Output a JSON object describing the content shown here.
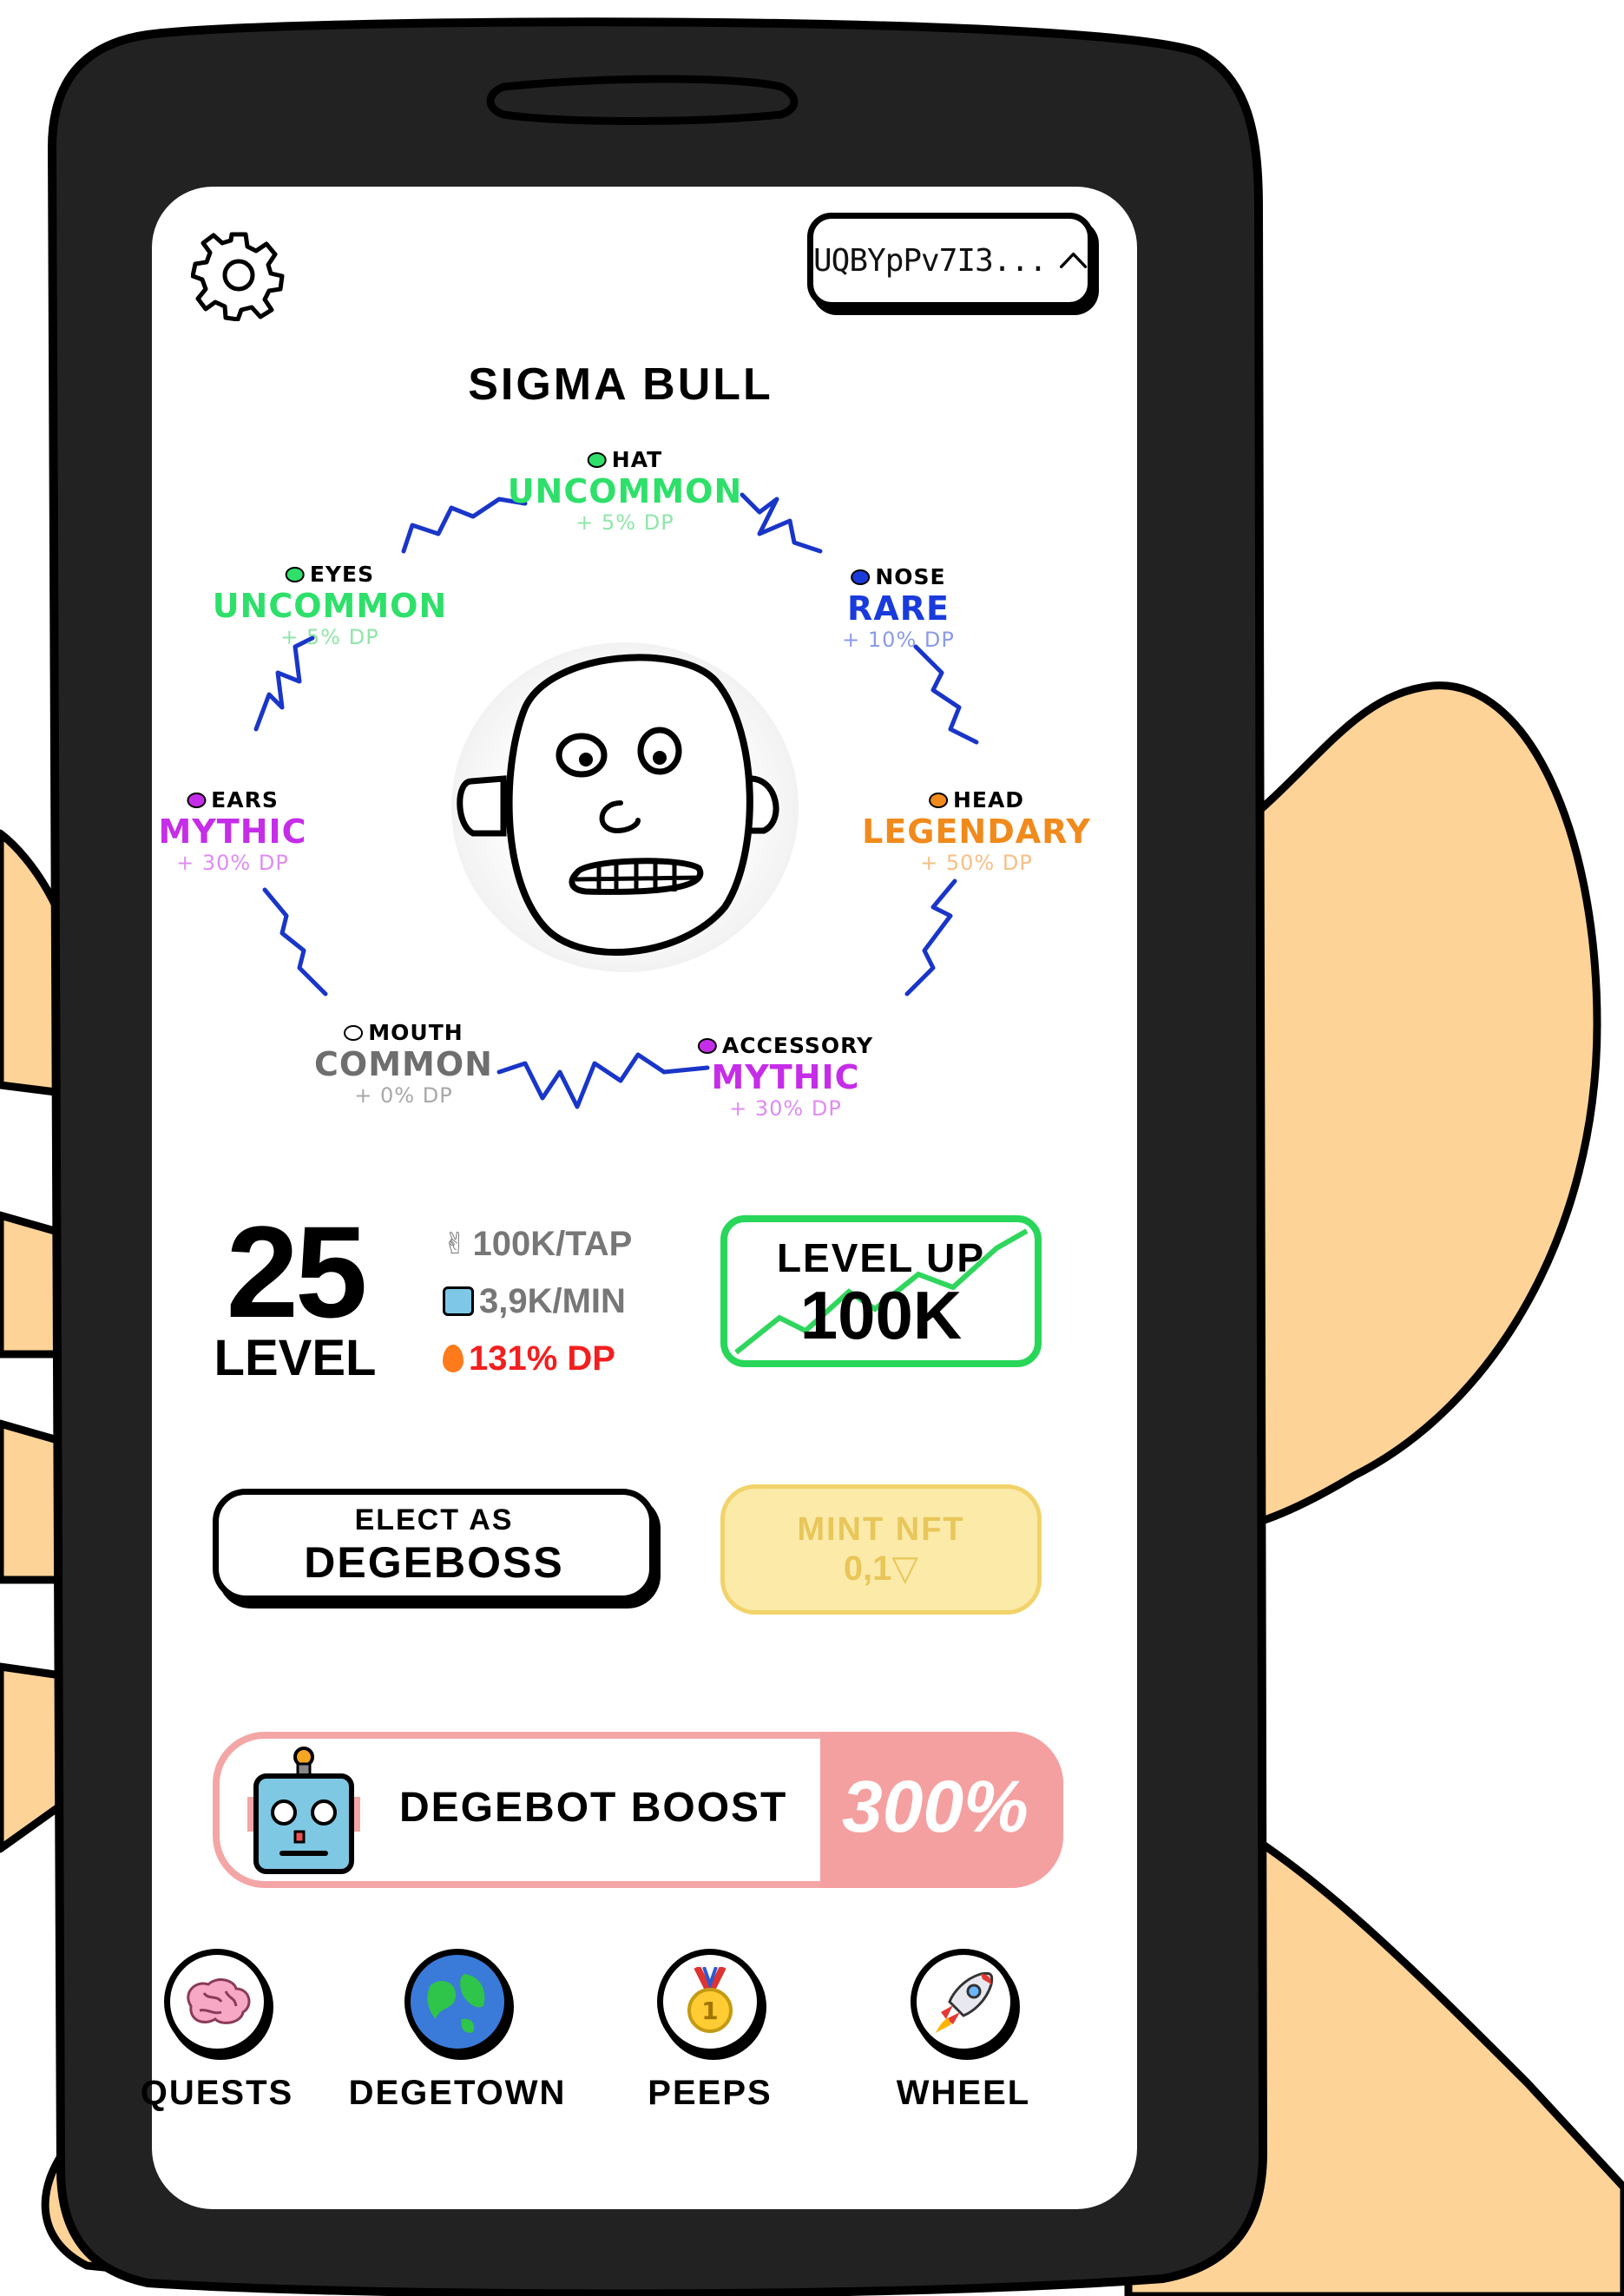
{
  "wallet": {
    "address": "UQBYpPv7I3..."
  },
  "character": {
    "name": "SIGMA BULL"
  },
  "traits": [
    {
      "slot": "HAT",
      "rarity": "UNCOMMON",
      "bonus": "+ 5% DP",
      "color": "#2ee06a",
      "dot": "#2ee06a"
    },
    {
      "slot": "EYES",
      "rarity": "UNCOMMON",
      "bonus": "+ 5% DP",
      "color": "#2ee06a",
      "dot": "#2ee06a"
    },
    {
      "slot": "NOSE",
      "rarity": "RARE",
      "bonus": "+ 10% DP",
      "color": "#1a3bdc",
      "dot": "#1a3bdc"
    },
    {
      "slot": "EARS",
      "rarity": "MYTHIC",
      "bonus": "+ 30% DP",
      "color": "#c62de8",
      "dot": "#c62de8"
    },
    {
      "slot": "HEAD",
      "rarity": "LEGENDARY",
      "bonus": "+ 50% DP",
      "color": "#f18a1c",
      "dot": "#f18a1c"
    },
    {
      "slot": "MOUTH",
      "rarity": "COMMON",
      "bonus": "+ 0% DP",
      "color": "#6e6e6e",
      "dot": "#ffffff"
    },
    {
      "slot": "ACCESSORY",
      "rarity": "MYTHIC",
      "bonus": "+ 30% DP",
      "color": "#c62de8",
      "dot": "#c62de8"
    }
  ],
  "stats": {
    "level_number": "25",
    "level_label": "LEVEL",
    "per_tap": "100K/TAP",
    "per_min": "3,9K/MIN",
    "dp": "131% DP"
  },
  "level_up": {
    "label": "LEVEL UP",
    "cost": "100K"
  },
  "elect": {
    "line1": "ELECT AS",
    "line2": "DEGEBOSS"
  },
  "mint": {
    "line1": "MINT NFT",
    "line2": "0,1▽"
  },
  "boost": {
    "label": "DEGEBOT BOOST",
    "value": "300%",
    "percent": 300
  },
  "nav": [
    {
      "label": "QUESTS",
      "icon": "brain-icon"
    },
    {
      "label": "DEGETOWN",
      "icon": "globe-icon"
    },
    {
      "label": "PEEPS",
      "icon": "medal-icon"
    },
    {
      "label": "WHEEL",
      "icon": "rocket-icon"
    }
  ]
}
